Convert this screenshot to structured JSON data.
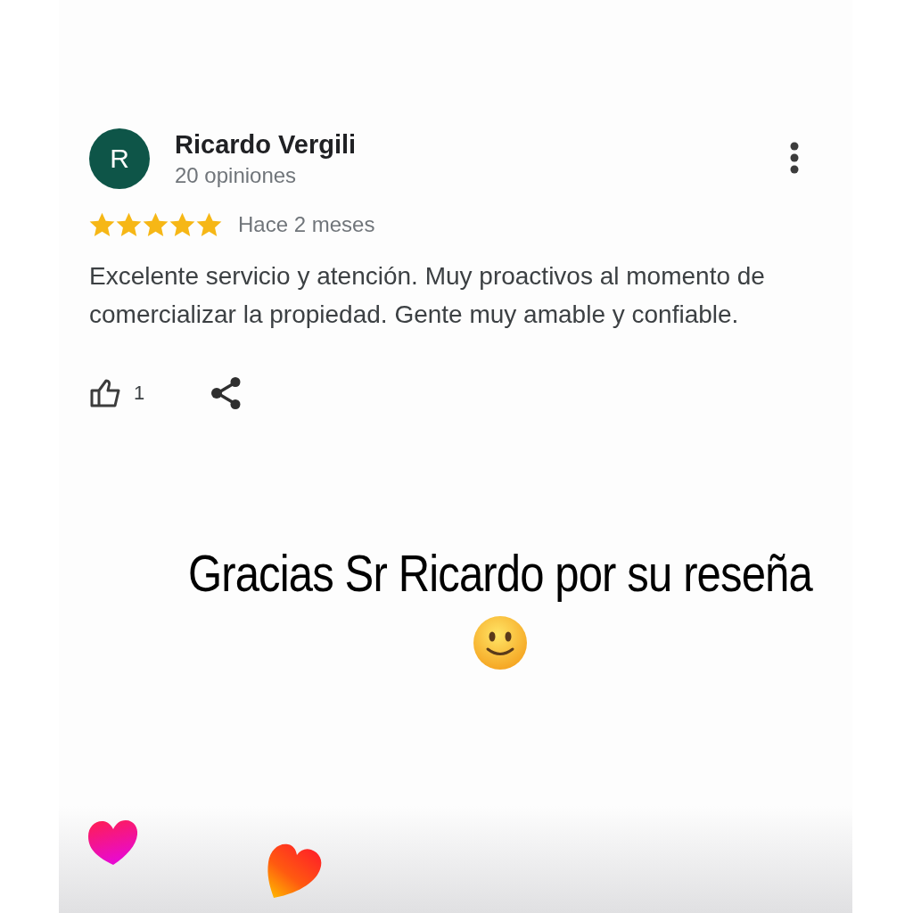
{
  "reviewer": {
    "initial": "R",
    "name": "Ricardo Vergili",
    "reviews": "20 opiniones"
  },
  "rating": {
    "stars": 5,
    "time": "Hace 2 meses"
  },
  "text": "Excelente servicio y atención. Muy proactivos al momento de comercializar la propiedad. Gente muy amable y confiable.",
  "likes": "1",
  "caption": "Gracias Sr Ricardo por su reseña"
}
